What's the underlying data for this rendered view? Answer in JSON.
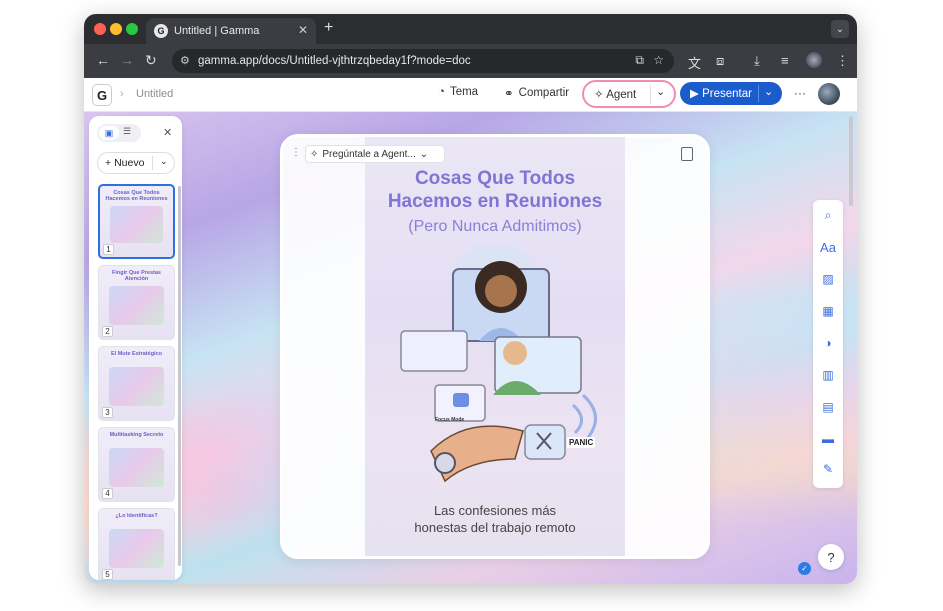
{
  "browser": {
    "tab_title": "Untitled | Gamma",
    "tab_favicon": "G",
    "url": "gamma.app/docs/Untitled-vjthtrzqbeday1f?mode=doc",
    "traffic_colors": [
      "#ff5f57",
      "#febc2e",
      "#28c840"
    ]
  },
  "app": {
    "logo": "G",
    "breadcrumb_sep": "›",
    "doc_title": "Untitled",
    "theme_label": "Tema",
    "share_label": "Compartir",
    "agent_label": "Agent",
    "present_label": "Presentar",
    "accent": "#1b5ccd",
    "agent_border": "#f28bb6"
  },
  "sidebar": {
    "new_label": "Nuevo",
    "thumbnails": [
      {
        "num": "1",
        "title": "Cosas Que Todos Hacemos en Reuniones"
      },
      {
        "num": "2",
        "title": "Fingir Que Prestas Atención"
      },
      {
        "num": "3",
        "title": "El Mute Estratégico"
      },
      {
        "num": "4",
        "title": "Multitasking Secreto"
      },
      {
        "num": "5",
        "title": "¿Lo Identificas?"
      }
    ]
  },
  "card": {
    "ask_label": "Pregúntale a Agent...",
    "title_line1": "Cosas Que Todos",
    "title_line2": "Hacemos en Reuniones",
    "subtitle": "(Pero Nunca Admitimos)",
    "mute_label": "Focus Mode",
    "panic_label": "PANIC",
    "footer_line1": "Las confesiones más",
    "footer_line2": "honestas del trabajo remoto"
  },
  "right_toolbar": {
    "icons": [
      "search-icon",
      "text-icon",
      "image-icon",
      "blocks-icon",
      "toggle-icon",
      "chart-icon",
      "table-icon",
      "card-icon",
      "draw-icon"
    ]
  },
  "help_label": "?"
}
